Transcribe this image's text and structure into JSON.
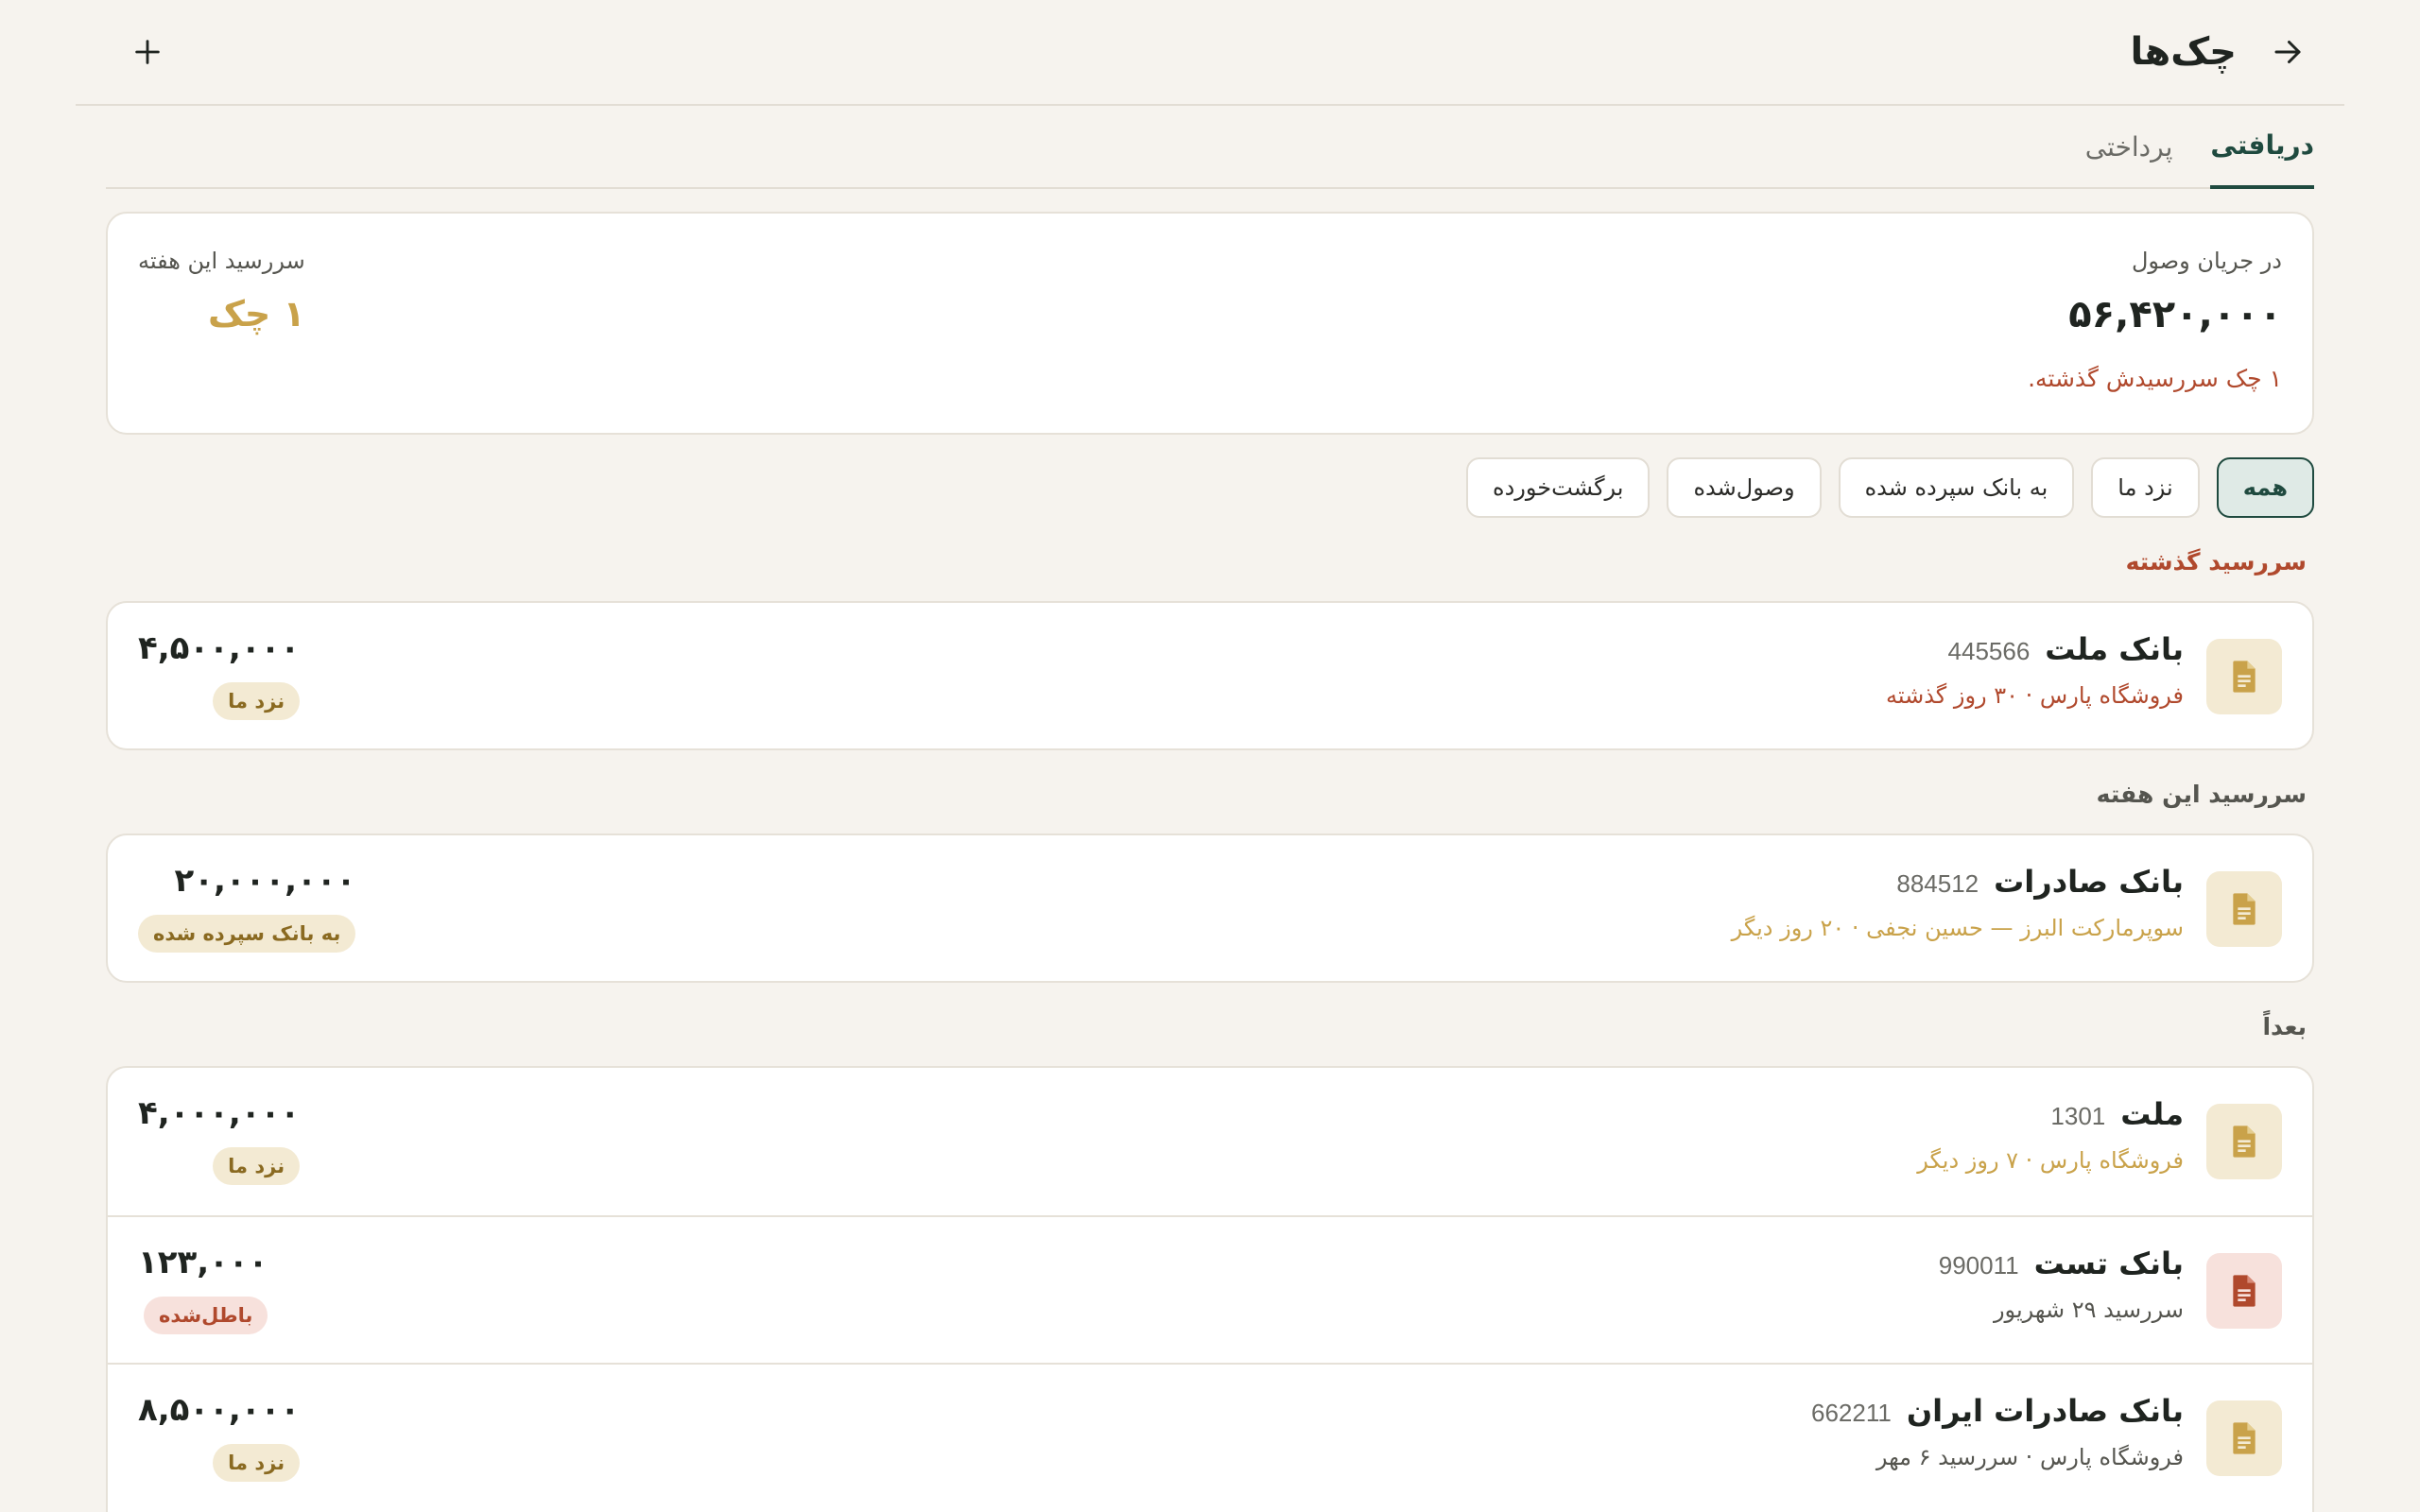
{
  "header": {
    "title": "چک‌ها"
  },
  "tabs": [
    {
      "label": "دریافتی",
      "active": true
    },
    {
      "label": "پرداختی",
      "active": false
    }
  ],
  "summary": {
    "in_collection_label": "در جریان وصول",
    "in_collection_value": "۵۶,۴۲۰,۰۰۰",
    "overdue_alert": "۱ چک سررسیدش گذشته.",
    "due_week_label": "سررسید این هفته",
    "due_week_value": "۱ چک"
  },
  "filters": [
    {
      "label": "همه",
      "active": true
    },
    {
      "label": "نزد ما",
      "active": false
    },
    {
      "label": "به بانک سپرده شده",
      "active": false
    },
    {
      "label": "وصول‌شده",
      "active": false
    },
    {
      "label": "برگشت‌خورده",
      "active": false
    }
  ],
  "sections": {
    "overdue": "سررسید گذشته",
    "this_week": "سررسید این هفته",
    "later": "بعداً"
  },
  "cheques": [
    {
      "bank": "بانک ملت",
      "serial": "445566",
      "sub": "فروشگاه پارس · ۳۰ روز گذشته",
      "amount": "۴,۵۰۰,۰۰۰",
      "status": "نزد ما",
      "icon": "document-icon"
    },
    {
      "bank": "بانک صادرات",
      "serial": "884512",
      "sub": "سوپرمارکت البرز — حسین نجفی · ۲۰ روز دیگر",
      "amount": "۲۰,۰۰۰,۰۰۰",
      "status": "به بانک سپرده شده",
      "icon": "document-icon"
    },
    {
      "bank": "ملت",
      "serial": "1301",
      "sub": "فروشگاه پارس · ۷ روز دیگر",
      "amount": "۴,۰۰۰,۰۰۰",
      "status": "نزد ما",
      "icon": "document-icon"
    },
    {
      "bank": "بانک تست",
      "serial": "990011",
      "sub": "سررسید ۲۹ شهریور",
      "amount": "۱۲۳,۰۰۰",
      "status": "باطل‌شده",
      "icon": "document-icon"
    },
    {
      "bank": "بانک صادرات ایران",
      "serial": "662211",
      "sub": "فروشگاه پارس · سررسید ۶ مهر",
      "amount": "۸,۵۰۰,۰۰۰",
      "status": "نزد ما",
      "icon": "document-icon"
    }
  ],
  "colors": {
    "accent": "#1f4a3f",
    "warning": "#b0492d",
    "gold": "#c9a24a",
    "background": "#f6f3ee"
  }
}
